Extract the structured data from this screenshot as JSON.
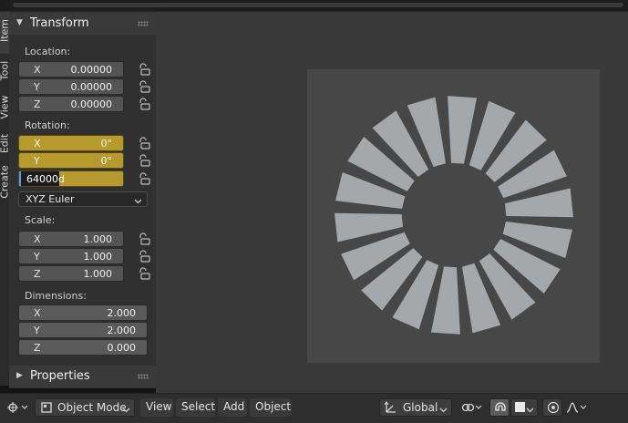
{
  "sidebar_tabs": [
    "Item",
    "Tool",
    "View",
    "Edit",
    "Create"
  ],
  "transform_panel": {
    "title": "Transform",
    "location": {
      "label": "Location:",
      "x": {
        "axis": "X",
        "value": "0.00000"
      },
      "y": {
        "axis": "Y",
        "value": "0.00000"
      },
      "z": {
        "axis": "Z",
        "value": "0.00000"
      }
    },
    "rotation": {
      "label": "Rotation:",
      "x": {
        "axis": "X",
        "value": "0°"
      },
      "y": {
        "axis": "Y",
        "value": "0°"
      },
      "z_edit_text": "64000d",
      "mode": "XYZ Euler"
    },
    "scale": {
      "label": "Scale:",
      "x": {
        "axis": "X",
        "value": "1.000"
      },
      "y": {
        "axis": "Y",
        "value": "1.000"
      },
      "z": {
        "axis": "Z",
        "value": "1.000"
      }
    },
    "dimensions": {
      "label": "Dimensions:",
      "x": {
        "axis": "X",
        "value": "2.000"
      },
      "y": {
        "axis": "Y",
        "value": "2.000"
      },
      "z": {
        "axis": "Z",
        "value": "0.000"
      }
    }
  },
  "properties_panel": {
    "title": "Properties"
  },
  "toolbar": {
    "mode": "Object Mode",
    "menu": [
      "View",
      "Select",
      "Add",
      "Object"
    ],
    "orientation": "Global"
  },
  "colors": {
    "animated_field": "#b69a2d",
    "active_edit_cursor": "#4aa3e8",
    "ray_segment": "#a4a8ab"
  },
  "icons": [
    "editor-type-icon",
    "object-mode-icon",
    "transform-orientation-icon",
    "snap-icon",
    "proportional-edit-icon",
    "falloff-curve-icon",
    "lock-icon",
    "chevron-down-icon",
    "grip-icon"
  ]
}
